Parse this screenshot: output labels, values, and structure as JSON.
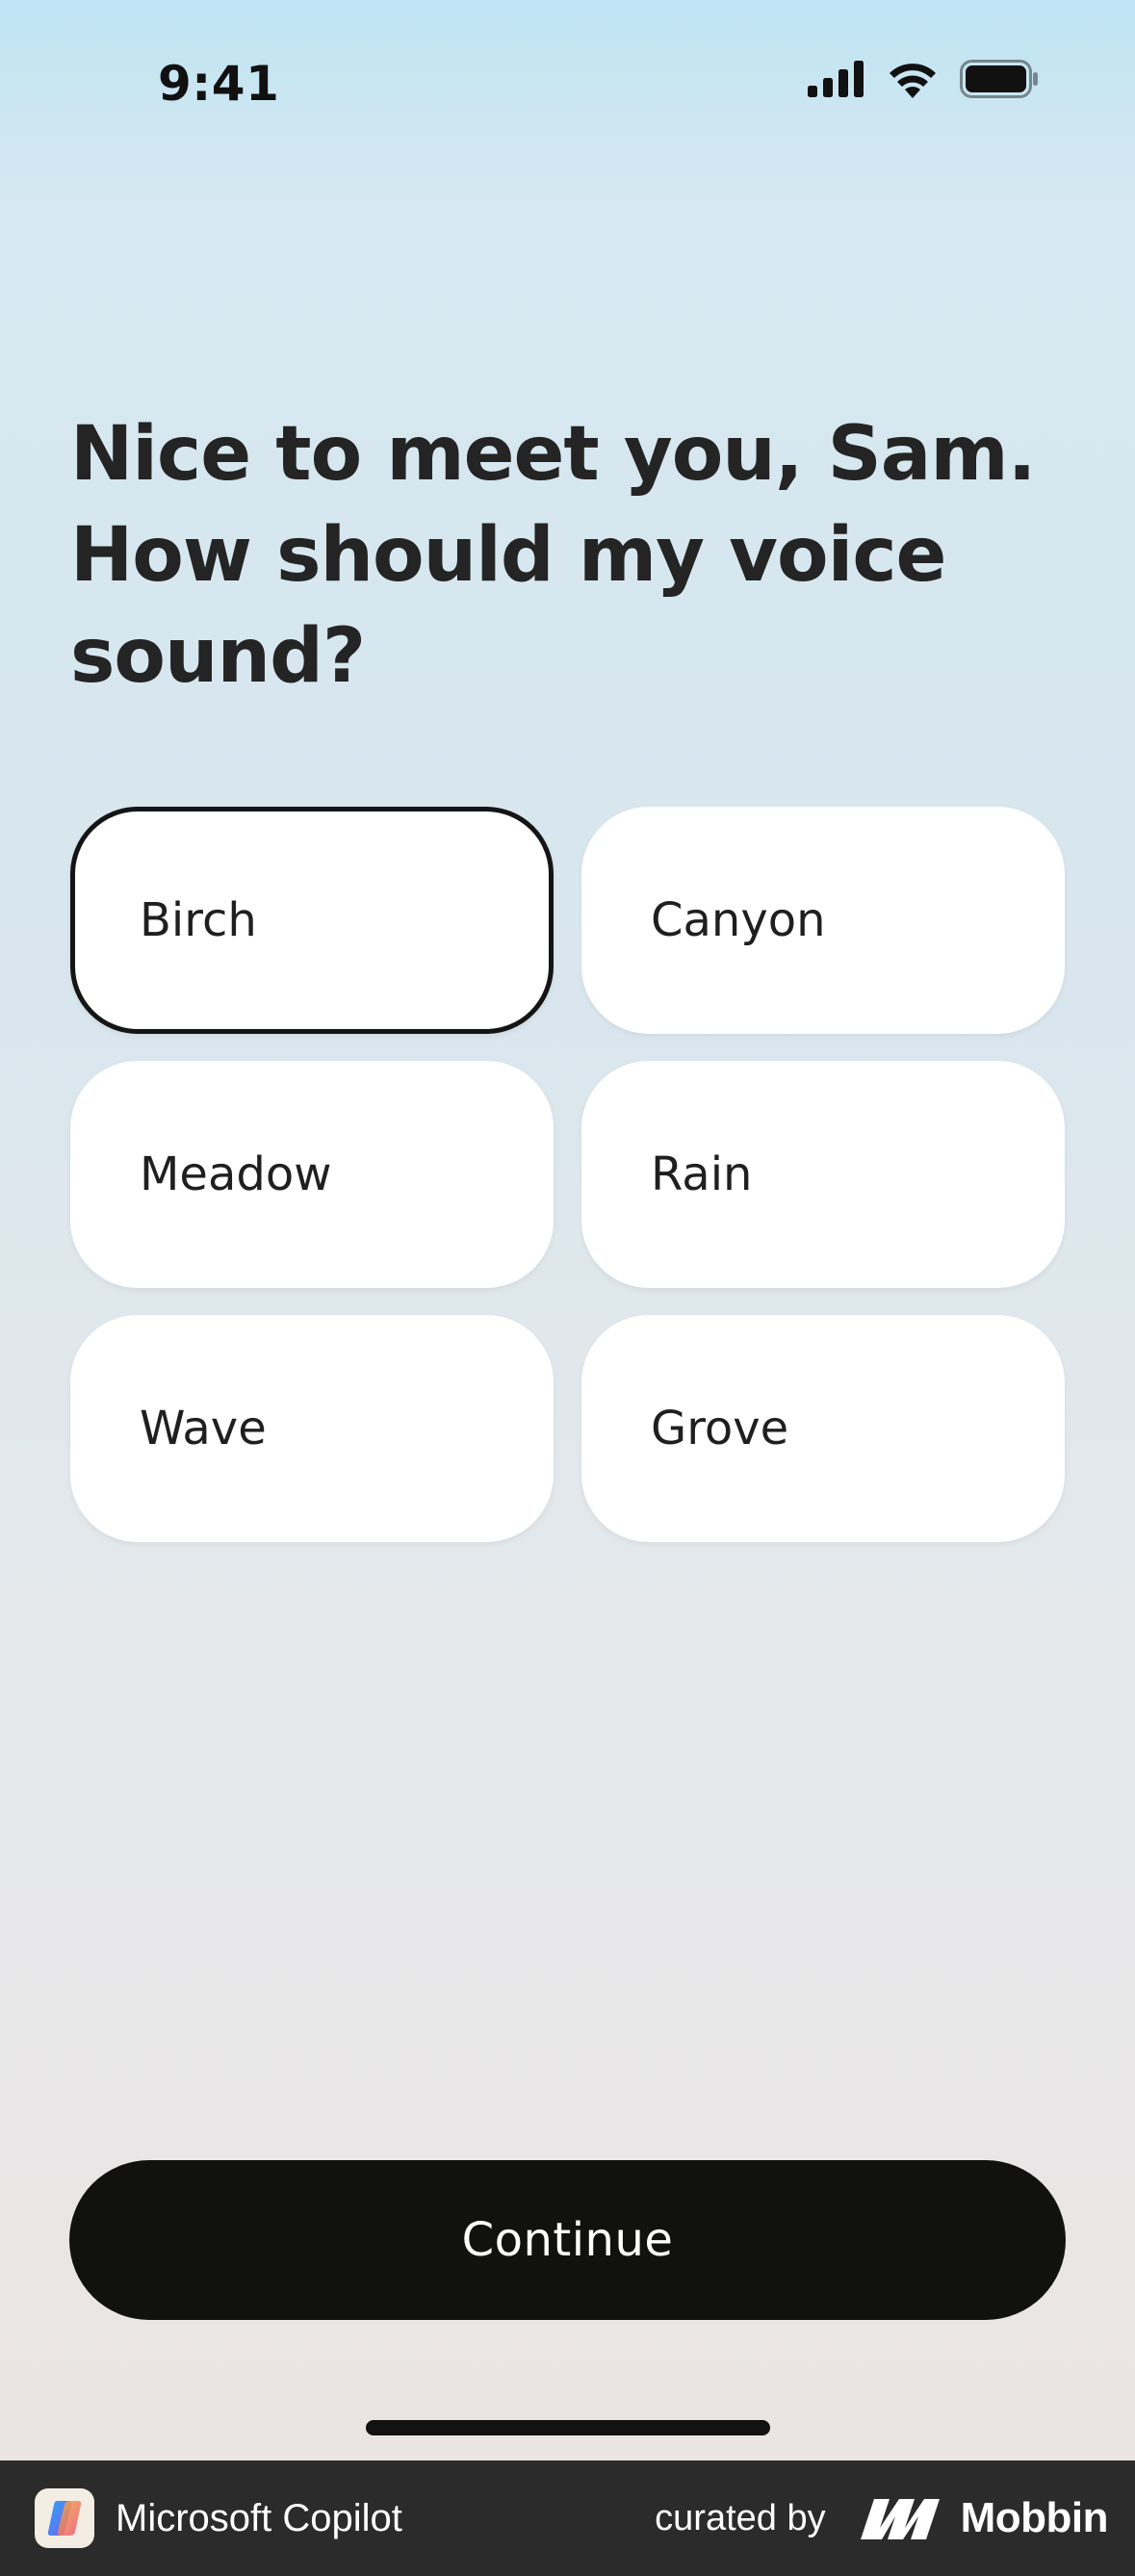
{
  "status_bar": {
    "time": "9:41",
    "icons": [
      "cellular-signal-icon",
      "wifi-icon",
      "battery-icon"
    ]
  },
  "onboarding": {
    "title": "Nice to meet you, Sam. How should my voice sound?",
    "voices": [
      {
        "label": "Birch",
        "selected": true
      },
      {
        "label": "Canyon",
        "selected": false
      },
      {
        "label": "Meadow",
        "selected": false
      },
      {
        "label": "Rain",
        "selected": false
      },
      {
        "label": "Wave",
        "selected": false
      },
      {
        "label": "Grove",
        "selected": false
      }
    ],
    "continue_label": "Continue"
  },
  "footer": {
    "app_name": "Microsoft Copilot",
    "curated_by": "curated by",
    "brand": "Mobbin"
  },
  "colors": {
    "primary_button": "#111110",
    "selected_border": "#151515",
    "option_background": "#ffffff",
    "footer_background": "#2b2b2b"
  }
}
